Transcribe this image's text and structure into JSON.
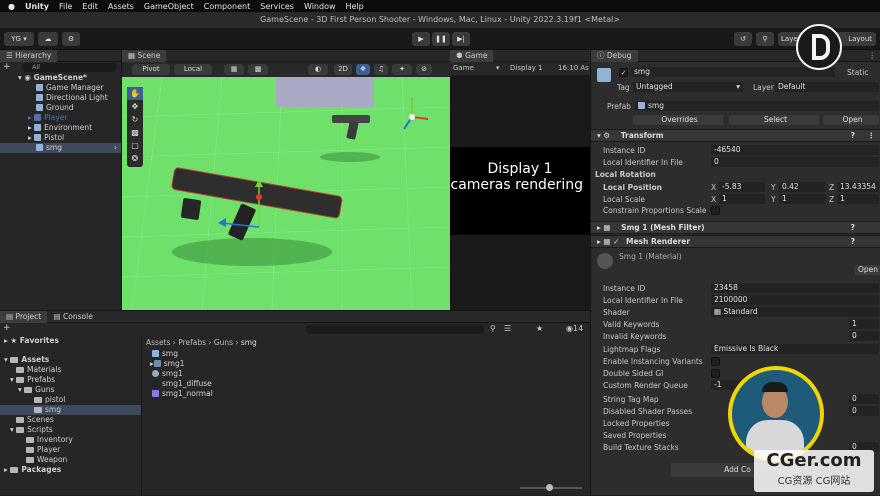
{
  "mac_menu": {
    "app": "Unity",
    "items": [
      "File",
      "Edit",
      "Assets",
      "GameObject",
      "Component",
      "Services",
      "Window",
      "Help"
    ]
  },
  "window_title": "GameScene - 3D First Person Shooter - Windows, Mac, Linux - Unity 2022.3.19f1 <Metal>",
  "toolbar": {
    "account": "YG",
    "layers": "Layers",
    "layout": "Layout"
  },
  "hierarchy": {
    "tab": "Hierarchy",
    "search_placeholder": "All",
    "scene": "GameScene*",
    "items": [
      "Game Manager",
      "Directional Light",
      "Ground",
      "Player",
      "Environment",
      "Pistol",
      "smg"
    ]
  },
  "scene_view": {
    "tab": "Scene",
    "pivot": "Pivot",
    "local": "Local",
    "mode_2d": "2D"
  },
  "game_view": {
    "tab": "Game",
    "display_dropdown": "Game",
    "display": "Display 1",
    "aspect": "16:10 As",
    "message_title": "Display 1",
    "message_body": "No cameras rendering"
  },
  "project": {
    "tab": "Project",
    "console_tab": "Console",
    "favorites": "Favorites",
    "assets": "Assets",
    "tree": [
      "Materials",
      "Prefabs",
      "Guns",
      "pistol",
      "smg",
      "Scenes",
      "Scripts",
      "Inventory",
      "Player",
      "Weapon"
    ],
    "packages": "Packages",
    "breadcrumb": [
      "Assets",
      "Prefabs",
      "Guns",
      "smg"
    ],
    "files": [
      "smg",
      "smg1",
      "smg1",
      "smg1_diffuse",
      "smg1_normal"
    ],
    "hidden_count": "14"
  },
  "inspector": {
    "tab": "Debug",
    "object_name": "smg",
    "static_label": "Static",
    "tag_label": "Tag",
    "tag": "Untagged",
    "layer_label": "Layer",
    "layer": "Default",
    "prefab_label": "Prefab",
    "prefab": "smg",
    "overrides": "Overrides",
    "select": "Select",
    "open": "Open",
    "transform": "Transform",
    "instance_id_label": "Instance ID",
    "instance_id": "-46540",
    "local_identifier_label": "Local Identifier In File",
    "local_identifier": "0",
    "local_rotation": "Local Rotation",
    "local_position": "Local Position",
    "pos_x": "-5.83",
    "pos_y": "0.42",
    "pos_z": "13.43354",
    "local_scale": "Local Scale",
    "scale_x": "1",
    "scale_y": "1",
    "scale_z": "1",
    "constrain": "Constrain Proportions Scale",
    "mesh_filter": "Smg 1 (Mesh Filter)",
    "mesh_renderer": "Mesh Renderer",
    "material": "Smg 1 (Material)",
    "material_open": "Open",
    "mat_instance_id": "23458",
    "mat_local_identifier": "2100000",
    "shader_label": "Shader",
    "shader": "Standard",
    "rows": [
      "Valid Keywords",
      "Invalid Keywords",
      "Lightmap Flags",
      "Enable Instancing Variants",
      "Double Sided GI",
      "Custom Render Queue",
      "String Tag Map",
      "Disabled Shader Passes",
      "Locked Properties",
      "Saved Properties",
      "Build Texture Stacks"
    ],
    "valid_keywords": "1",
    "invalid_keywords": "0",
    "lightmap_flags": "Emissive Is Black",
    "custom_render_queue": "-1",
    "string_tag_map": "0",
    "disabled_passes": "0",
    "build_texture_stacks": "0",
    "add_component": "Add Co"
  },
  "watermark": {
    "brand": "CGer.com",
    "sub": "CG资源 CG网站"
  },
  "colors": {
    "scene_ground": "#6fe06a",
    "accent_blue": "#3e5f96"
  }
}
